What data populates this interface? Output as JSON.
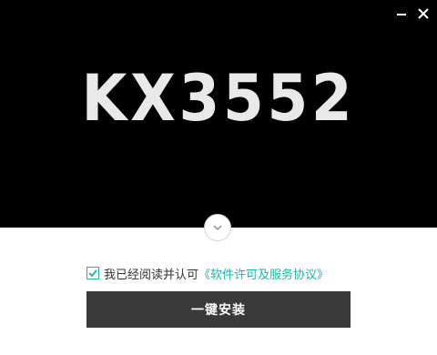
{
  "banner": {
    "logo_text": "KX3552",
    "background": "#000000",
    "logo_color": "#e9e9e9"
  },
  "window_controls": {
    "minimize_icon": "minimize-icon",
    "close_icon": "close-icon"
  },
  "expand": {
    "icon": "chevron-down-icon"
  },
  "agreement": {
    "checked": true,
    "text": "我已经阅读并认可",
    "link_text": "《软件许可及服务协议》",
    "accent_color": "#20b3a7"
  },
  "install_button": {
    "label": "一键安装",
    "background": "#3a3a3a"
  }
}
